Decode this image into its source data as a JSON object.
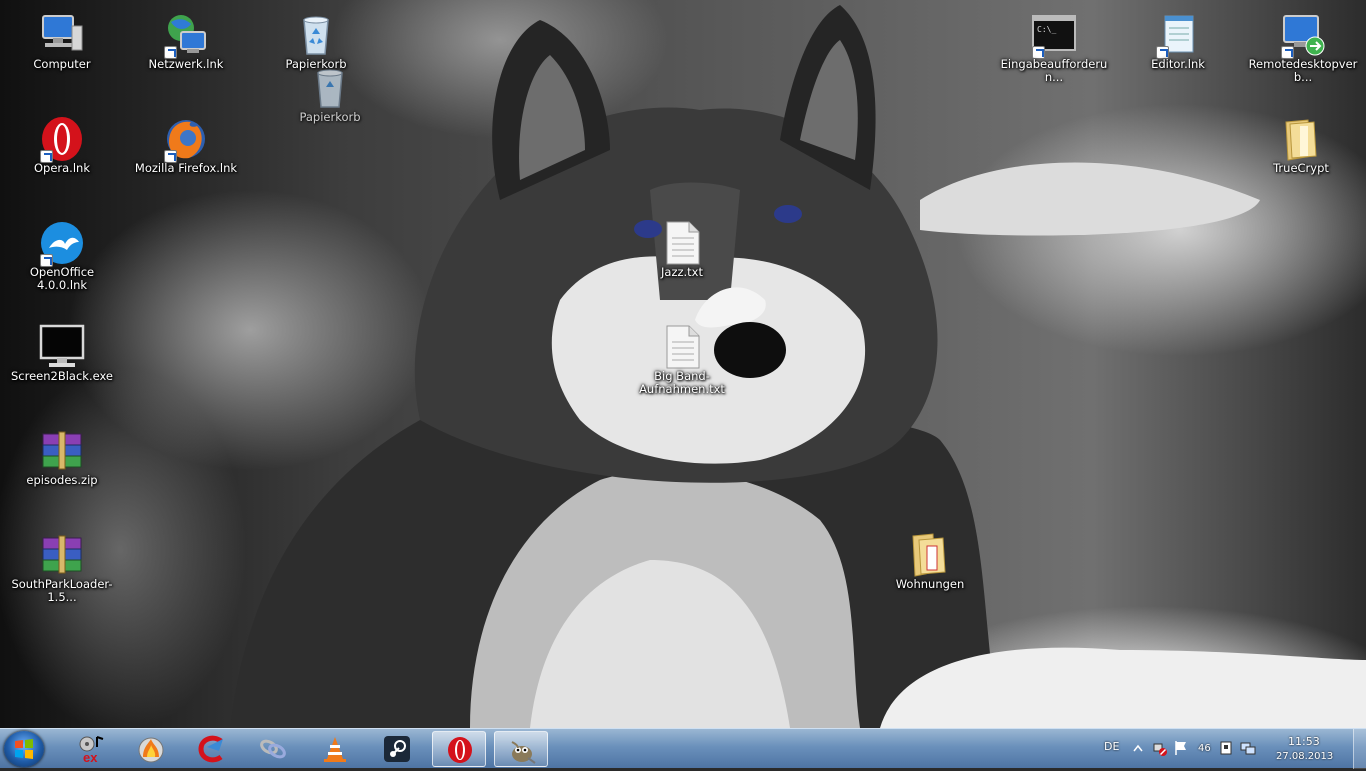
{
  "desktop": {
    "icons": [
      {
        "label": "Computer",
        "icon": "computer-icon"
      },
      {
        "label": "Netzwerk.lnk",
        "icon": "network-icon"
      },
      {
        "label": "Papierkorb",
        "icon": "recycle-bin-icon"
      },
      {
        "label": "Papierkorb",
        "icon": "recycle-bin-icon"
      },
      {
        "label": "Eingabeaufforderun...",
        "icon": "cmd-icon"
      },
      {
        "label": "Editor.lnk",
        "icon": "notepad-icon"
      },
      {
        "label": "Remotedesktopverb...",
        "icon": "remote-desktop-icon"
      },
      {
        "label": "Opera.lnk",
        "icon": "opera-icon"
      },
      {
        "label": "Mozilla Firefox.lnk",
        "icon": "firefox-icon"
      },
      {
        "label": "TrueCrypt",
        "icon": "folder-icon"
      },
      {
        "label": "OpenOffice 4.0.0.lnk",
        "icon": "openoffice-icon"
      },
      {
        "label": "Jazz.txt",
        "icon": "text-file-icon"
      },
      {
        "label": "Screen2Black.exe",
        "icon": "monitor-icon"
      },
      {
        "label": "Big Band-Aufnahmen.txt",
        "icon": "text-file-icon"
      },
      {
        "label": "episodes.zip",
        "icon": "winrar-archive-icon"
      },
      {
        "label": "Wohnungen",
        "icon": "folder-icon"
      },
      {
        "label": "SouthParkLoader-1.5...",
        "icon": "winrar-archive-icon"
      }
    ]
  },
  "taskbar": {
    "pinned": [
      {
        "name": "start-button",
        "icon": "windows-orb-icon"
      },
      {
        "name": "media-ex-app",
        "icon": "exact-audio-copy-icon"
      },
      {
        "name": "burn-app",
        "icon": "burning-disc-icon"
      },
      {
        "name": "ccleaner-app",
        "icon": "ccleaner-icon"
      },
      {
        "name": "network-tool-app",
        "icon": "chain-icon"
      },
      {
        "name": "vlc-app",
        "icon": "vlc-cone-icon"
      },
      {
        "name": "steam-app",
        "icon": "steam-icon"
      },
      {
        "name": "opera-app",
        "icon": "opera-icon"
      },
      {
        "name": "gimp-app",
        "icon": "gimp-icon"
      }
    ],
    "tray": {
      "language": "DE",
      "number_badge": "46",
      "time": "11:53",
      "date": "27.08.2013"
    }
  },
  "colors": {
    "taskbar": "#6e96c3",
    "opera_red": "#d4121b",
    "label_text": "#ffffff"
  }
}
